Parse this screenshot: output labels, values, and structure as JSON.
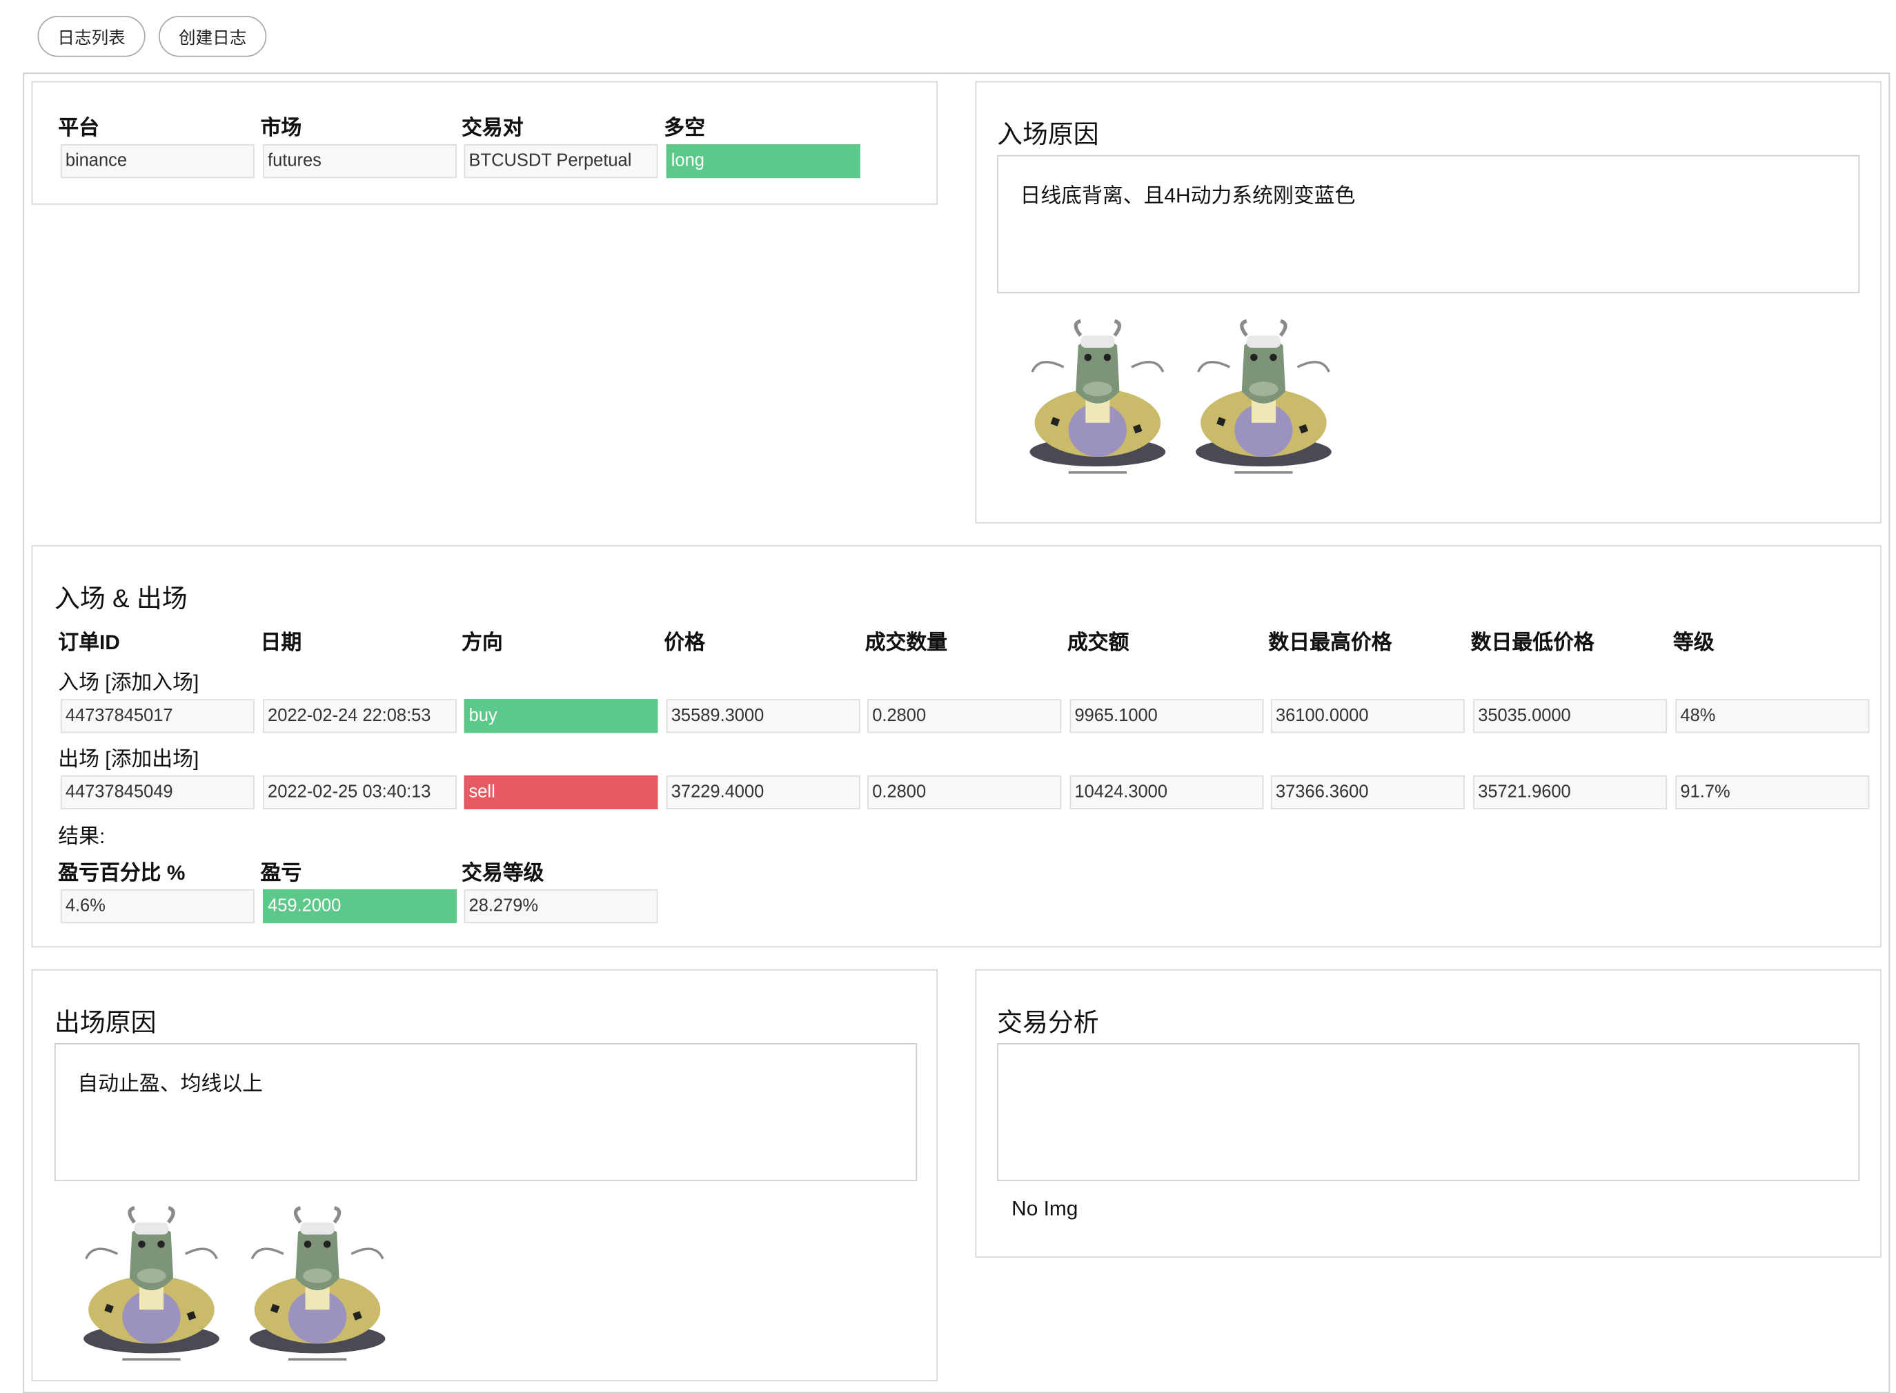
{
  "nav": {
    "list_label": "日志列表",
    "create_label": "创建日志"
  },
  "meta": {
    "headers": [
      "平台",
      "市场",
      "交易对",
      "多空"
    ],
    "values": [
      "binance",
      "futures",
      "BTCUSDT Perpetual",
      "long"
    ]
  },
  "entry_reason": {
    "title": "入场原因",
    "text": "日线底背离、且4H动力系统刚变蓝色"
  },
  "trades": {
    "title": "入场 & 出场",
    "headers": [
      "订单ID",
      "日期",
      "方向",
      "价格",
      "成交数量",
      "成交额",
      "数日最高价格",
      "数日最低价格",
      "等级"
    ],
    "entry_label": "入场 [添加入场]",
    "entry": [
      "44737845017",
      "2022-02-24 22:08:53",
      "buy",
      "35589.3000",
      "0.2800",
      "9965.1000",
      "36100.0000",
      "35035.0000",
      "48%"
    ],
    "exit_label": "出场 [添加出场]",
    "exit": [
      "44737845049",
      "2022-02-25 03:40:13",
      "sell",
      "37229.4000",
      "0.2800",
      "10424.3000",
      "37366.3600",
      "35721.9600",
      "91.7%"
    ],
    "result_label": "结果:",
    "result_headers": [
      "盈亏百分比 %",
      "盈亏",
      "交易等级"
    ],
    "result_values": [
      "4.6%",
      "459.2000",
      "28.279%"
    ]
  },
  "exit_reason": {
    "title": "出场原因",
    "text": "自动止盈、均线以上"
  },
  "analysis": {
    "title": "交易分析",
    "text": "",
    "no_img": "No Img"
  },
  "colors": {
    "long": "#5cc98a",
    "buy": "#5cc98a",
    "sell": "#e65b63",
    "profit": "#5cc98a"
  }
}
